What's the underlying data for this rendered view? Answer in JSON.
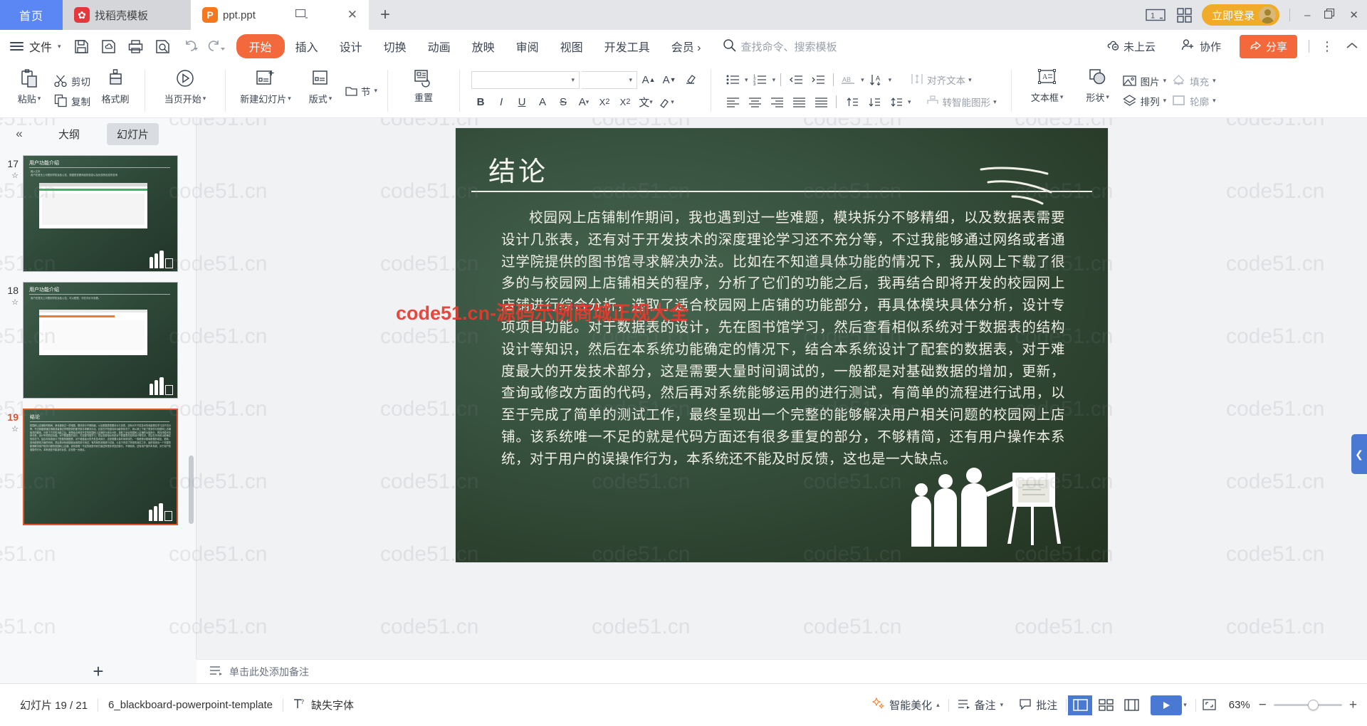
{
  "titlebar": {
    "home_label": "首页",
    "tabs": [
      {
        "label": "找稻壳模板",
        "icon": "daoke-icon",
        "active": false
      },
      {
        "label": "ppt.ppt",
        "icon": "ppt-file-icon",
        "active": true
      }
    ],
    "new_tab_icon": "plus-icon",
    "page_count_icon": "page-count-icon",
    "page_count_label": "1",
    "grid_icon": "grid-icon",
    "login_label": "立即登录",
    "window": {
      "minimize": "–",
      "restore": "❐",
      "close": "✕"
    }
  },
  "menubar": {
    "file_label": "文件",
    "quick_icons": [
      "save-icon",
      "save-as-cloud-icon",
      "print-icon",
      "print-preview-icon",
      "undo-icon",
      "redo-icon"
    ],
    "tabs": [
      {
        "label": "开始",
        "active": true
      },
      {
        "label": "插入",
        "active": false
      },
      {
        "label": "设计",
        "active": false
      },
      {
        "label": "切换",
        "active": false
      },
      {
        "label": "动画",
        "active": false
      },
      {
        "label": "放映",
        "active": false
      },
      {
        "label": "审阅",
        "active": false
      },
      {
        "label": "视图",
        "active": false
      },
      {
        "label": "开发工具",
        "active": false
      },
      {
        "label": "会员 ›",
        "active": false
      }
    ],
    "search_placeholder": "查找命令、搜索模板",
    "cloud_status": "未上云",
    "collab_label": "协作",
    "share_label": "分享",
    "more_icon": "more-vertical-icon",
    "collapse_icon": "chevron-up-icon"
  },
  "ribbon": {
    "paste_label": "粘贴",
    "copy_label": "复制",
    "cut_label": "剪切",
    "format_painter_label": "格式刷",
    "start_from_current_label": "当页开始",
    "new_slide_label": "新建幻灯片",
    "layout_label": "版式",
    "section_label": "节",
    "reset_label": "重置",
    "font_name": "",
    "font_size": "",
    "font_name_placeholder": "",
    "font_size_placeholder": "",
    "align_text_label": "对齐文本",
    "smart_art_label": "转智能图形",
    "textbox_label": "文本框",
    "shape_label": "形状",
    "picture_label": "图片",
    "fill_label": "填充",
    "arrange_label": "排列",
    "outline_label": "轮廓",
    "font_tools": [
      "bold-icon",
      "italic-icon",
      "underline-icon",
      "text-shadow-icon",
      "strikethrough-icon",
      "character-spacing-icon",
      "superscript-icon",
      "subscript-icon",
      "highlight-icon",
      "font-color-icon"
    ],
    "size_tools": [
      "increase-font-size-icon",
      "decrease-font-size-icon",
      "clear-format-icon"
    ],
    "list_tools": [
      "bullet-list-icon",
      "numbered-list-icon",
      "decrease-indent-icon",
      "increase-indent-icon"
    ],
    "align_tools": [
      "align-left-icon",
      "align-center-icon",
      "align-right-icon",
      "justify-icon",
      "distribute-icon"
    ],
    "spacing_tools": [
      "line-spacing-up-icon",
      "line-spacing-down-icon",
      "line-spacing-icon"
    ]
  },
  "slide_pane": {
    "collapse_icon": "double-chevron-left-icon",
    "tabs": [
      {
        "label": "大纲",
        "active": false
      },
      {
        "label": "幻灯片",
        "active": true
      }
    ],
    "thumbnails": [
      {
        "number": "17",
        "title": "用户功能介绍",
        "selected": false,
        "kind": "card"
      },
      {
        "number": "18",
        "title": "用户功能介绍",
        "selected": false,
        "kind": "card"
      },
      {
        "number": "19",
        "title": "结论",
        "selected": true,
        "kind": "text"
      }
    ],
    "thumb_subtitle": "输入文本\n用户在首页上可看到学校及各公告，按图是查看商品的信息以及优惠的信息的查询"
  },
  "slide": {
    "title": "结论",
    "body": "校园网上店铺制作期间，我也遇到过一些难题，模块拆分不够精细，以及数据表需要设计几张表，还有对于开发技术的深度理论学习还不充分等，不过我能够通过网络或者通过学院提供的图书馆寻求解决办法。比如在不知道具体功能的情况下，我从网上下载了很多的与校园网上店铺相关的程序，分析了它们的功能之后，我再结合即将开发的校园网上店铺进行综合分析，选取了适合校园网上店铺的功能部分，再具体模块具体分析，设计专项项目功能。对于数据表的设计，先在图书馆学习，然后查看相似系统对于数据表的结构设计等知识，然后在本系统功能确定的情况下，结合本系统设计了配套的数据表，对于难度最大的开发技术部分，这是需要大量时间调试的，一般都是对基础数据的增加，更新，查询或修改方面的代码，然后再对系统能够运用的进行测试，有简单的流程进行试用，以至于完成了简单的测试工作，最终呈现出一个完整的能够解决用户相关问题的校园网上店铺。该系统唯一不足的就是代码方面还有很多重复的部分，不够精简，还有用户操作本系统，对于用户的误操作行为，本系统还不能及时反馈，这也是一大缺点。"
  },
  "notes": {
    "icon": "notes-icon",
    "placeholder": "单击此处添加备注",
    "add_slide_icon": "plus-icon"
  },
  "statusbar": {
    "slide_count": "幻灯片 19 / 21",
    "template_name": "6_blackboard-powerpoint-template",
    "missing_font_label": "缺失字体",
    "missing_font_icon": "missing-font-icon",
    "beautify_label": "智能美化",
    "notes_label": "备注",
    "comment_label": "批注",
    "view_icons": [
      "normal-view-icon",
      "slide-sorter-icon",
      "reading-view-icon"
    ],
    "play_icon": "play-icon",
    "fit_icon": "fit-to-window-icon",
    "zoom_level": "63%",
    "zoom_out": "−",
    "zoom_in": "+"
  },
  "watermark": {
    "text": "code51.cn",
    "red_text": "code51.cn-源码示例商城正规大全"
  },
  "theme": {
    "accent_orange": "#f4693c",
    "accent_blue": "#4a79d4",
    "home_blue": "#5b87f5",
    "login_yellow": "#f0ab28",
    "selected_red": "#e2552a",
    "board_green": "#37523f"
  }
}
